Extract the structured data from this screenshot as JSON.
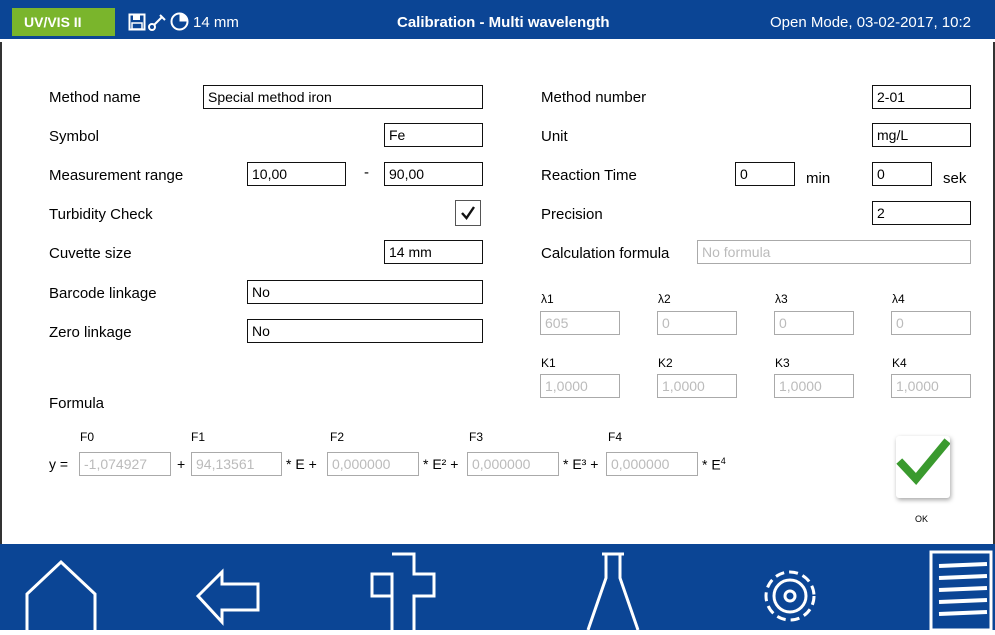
{
  "header": {
    "brand": "UV/VIS II",
    "cuvette": "14 mm",
    "title": "Calibration - Multi wavelength",
    "mode": "Open Mode, 03-02-2017, 10:2"
  },
  "form": {
    "method_name_label": "Method name",
    "method_name_value": "Special method iron",
    "symbol_label": "Symbol",
    "symbol_value": "Fe",
    "range_label": "Measurement range",
    "range_min": "10,00",
    "range_sep": "-",
    "range_max": "90,00",
    "turbidity_label": "Turbidity Check",
    "turbidity_checked": true,
    "cuvette_label": "Cuvette size",
    "cuvette_value": "14 mm",
    "barcode_label": "Barcode linkage",
    "barcode_value": "No",
    "zero_label": "Zero linkage",
    "zero_value": "No",
    "method_number_label": "Method number",
    "method_number_value": "2-01",
    "unit_label": "Unit",
    "unit_value": "mg/L",
    "reaction_label": "Reaction Time",
    "reaction_min_value": "0",
    "reaction_min_unit": "min",
    "reaction_sec_value": "0",
    "reaction_sec_unit": "sek",
    "precision_label": "Precision",
    "precision_value": "2",
    "calc_label": "Calculation formula",
    "calc_placeholder": "No formula"
  },
  "wavelengths": {
    "lambda_labels": [
      "λ1",
      "λ2",
      "λ3",
      "λ4"
    ],
    "lambda_values": [
      "605",
      "0",
      "0",
      "0"
    ],
    "k_labels": [
      "K1",
      "K2",
      "K3",
      "K4"
    ],
    "k_values": [
      "1,0000",
      "1,0000",
      "1,0000",
      "1,0000"
    ]
  },
  "formula": {
    "title": "Formula",
    "f_labels": [
      "F0",
      "F1",
      "F2",
      "F3",
      "F4"
    ],
    "y_prefix": "y =",
    "f_values": [
      "-1,074927",
      "94,13561",
      "0,000000",
      "0,000000",
      "0,000000"
    ],
    "plus": "+",
    "term1": "* E +",
    "term2": "* E² +",
    "term3": "* E³ +",
    "term4": "* E"
  },
  "ok": {
    "label": "OK",
    "color": "#3a9a2e"
  },
  "footer_icons": [
    "home-icon",
    "back-icon",
    "add-icon",
    "flask-icon",
    "settings-icon",
    "menu-icon"
  ],
  "colors": {
    "header_bg": "#0b4595",
    "brand_bg": "#7ab52c"
  }
}
